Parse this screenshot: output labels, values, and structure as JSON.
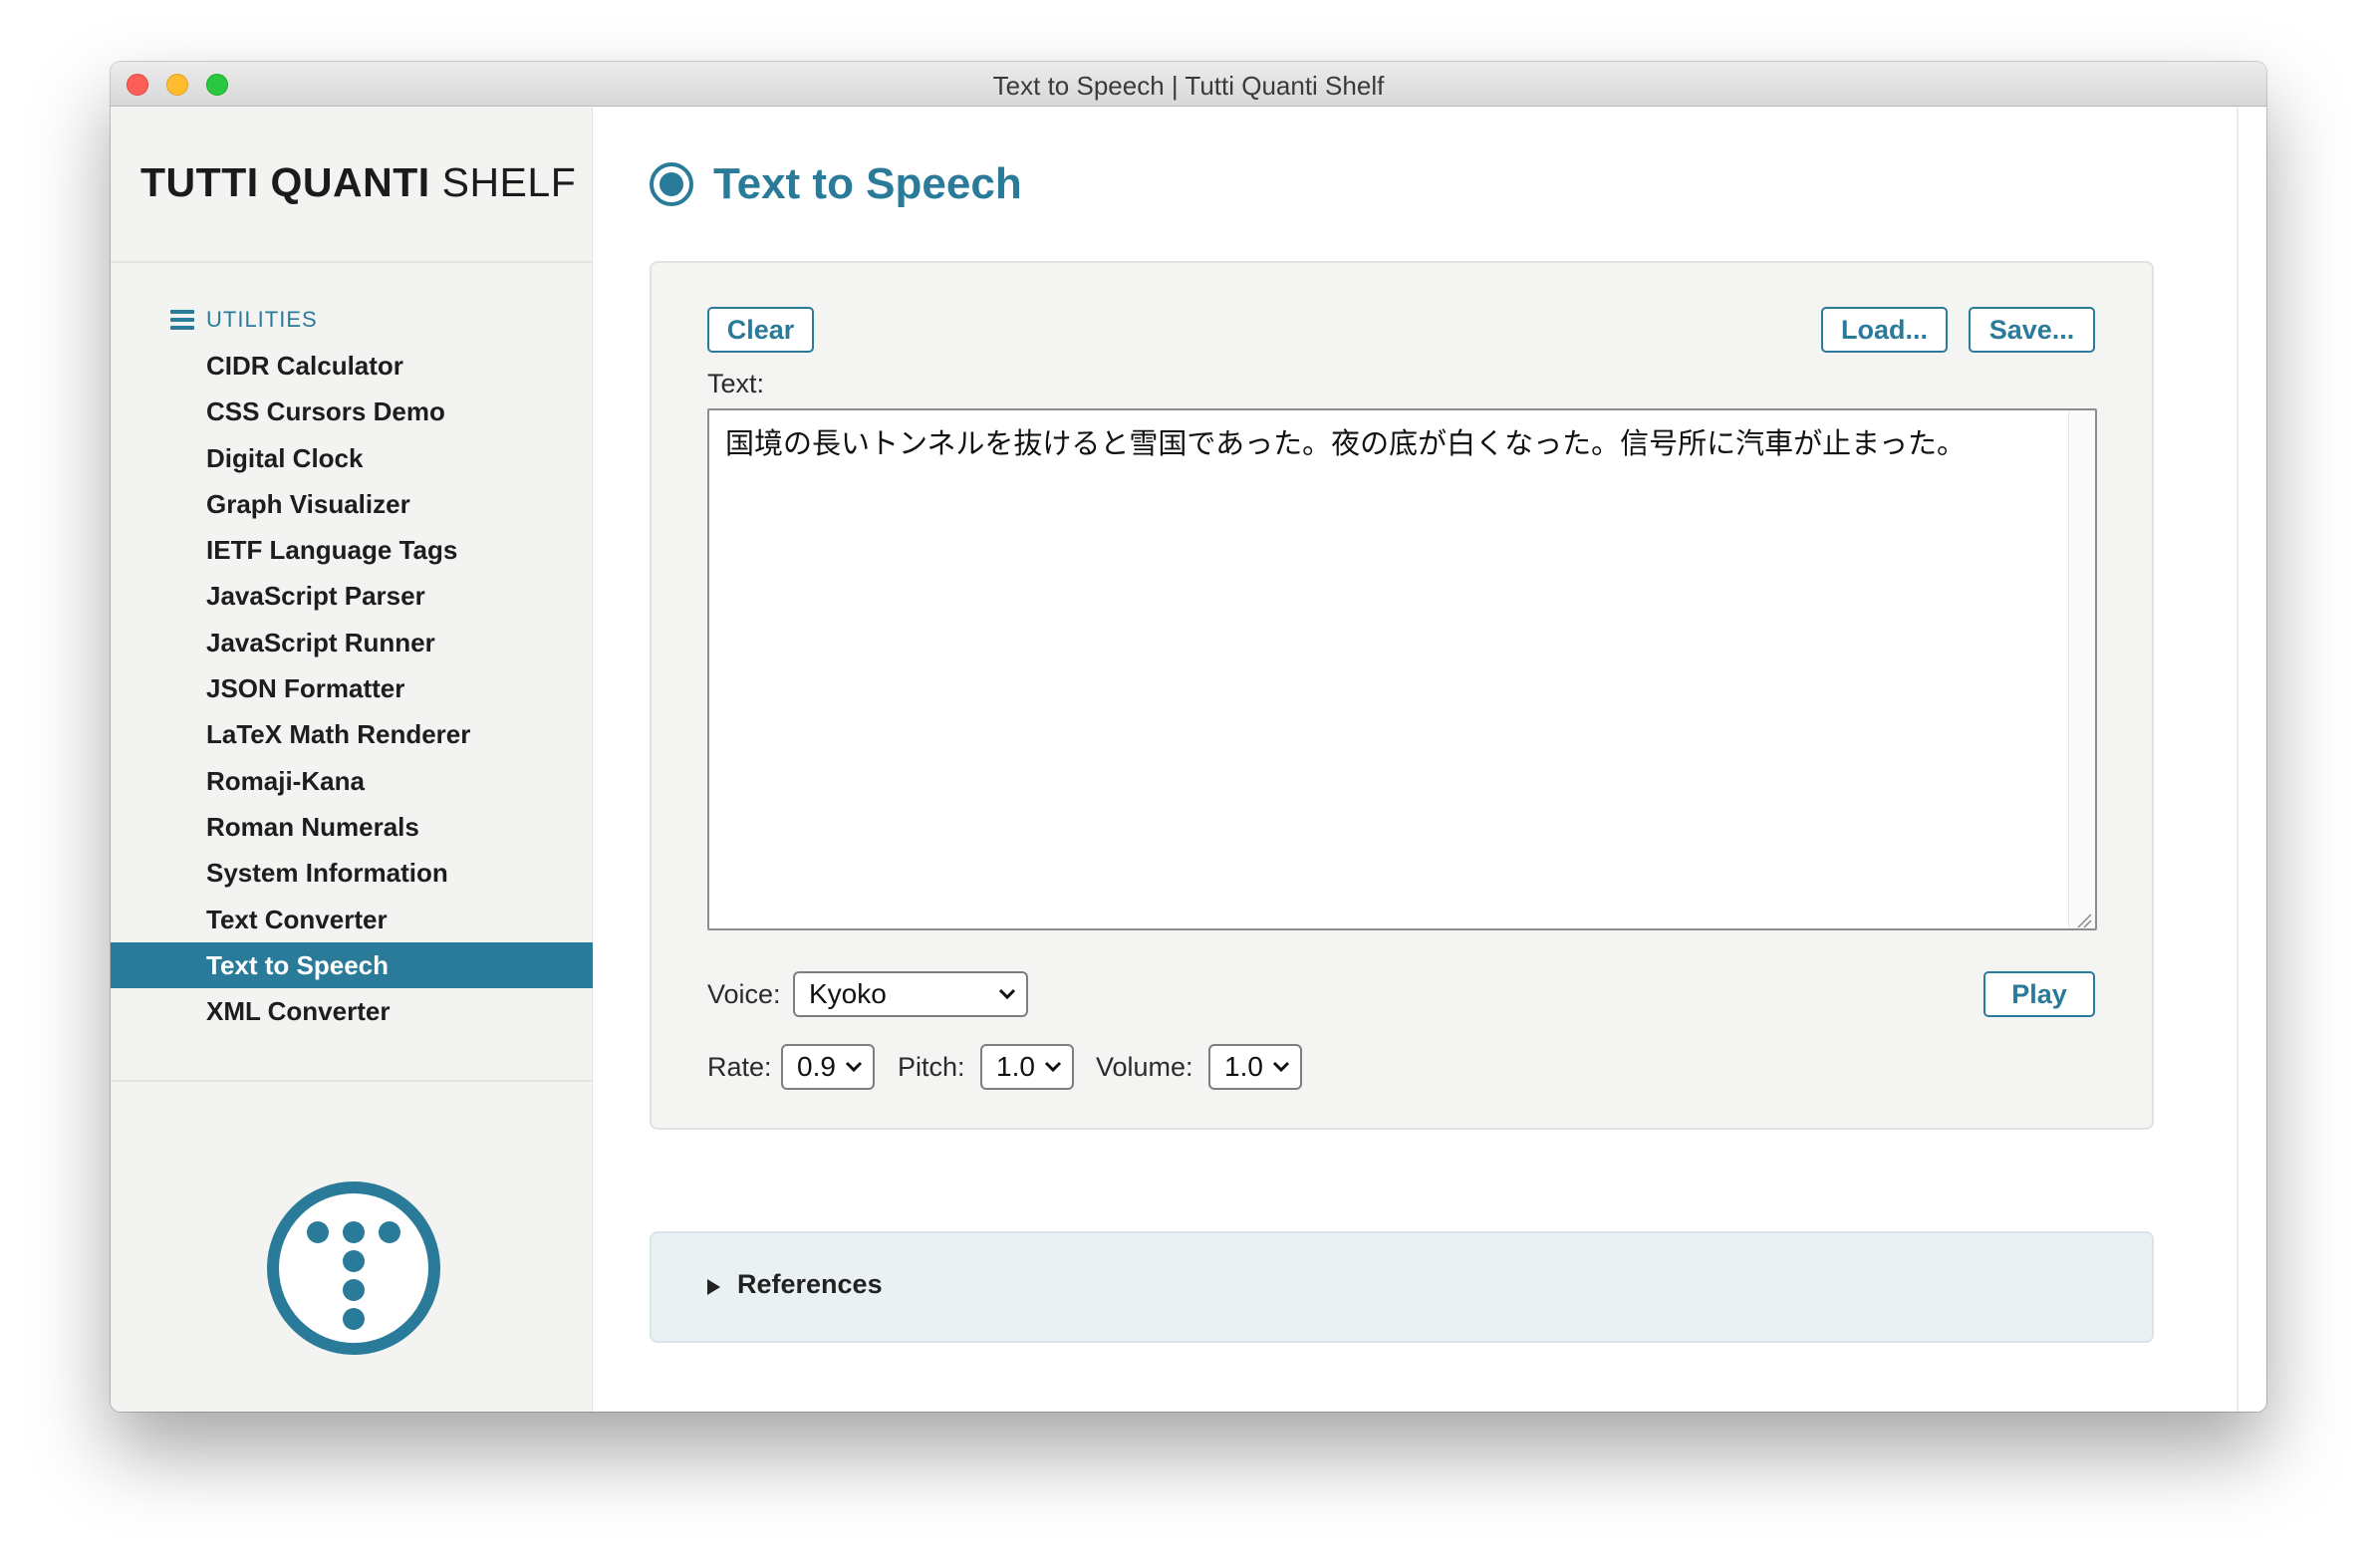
{
  "window": {
    "title": "Text to Speech | Tutti Quanti Shelf"
  },
  "sidebar": {
    "brand_bold": "TUTTI QUANTI",
    "brand_light": "SHELF",
    "section_label": "UTILITIES",
    "items": [
      {
        "label": "CIDR Calculator"
      },
      {
        "label": "CSS Cursors Demo"
      },
      {
        "label": "Digital Clock"
      },
      {
        "label": "Graph Visualizer"
      },
      {
        "label": "IETF Language Tags"
      },
      {
        "label": "JavaScript Parser"
      },
      {
        "label": "JavaScript Runner"
      },
      {
        "label": "JSON Formatter"
      },
      {
        "label": "LaTeX Math Renderer"
      },
      {
        "label": "Romaji-Kana"
      },
      {
        "label": "Roman Numerals"
      },
      {
        "label": "System Information"
      },
      {
        "label": "Text Converter"
      },
      {
        "label": "Text to Speech",
        "active": true
      },
      {
        "label": "XML Converter"
      }
    ]
  },
  "main": {
    "title": "Text to Speech",
    "buttons": {
      "clear": "Clear",
      "load": "Load...",
      "save": "Save...",
      "play": "Play"
    },
    "text_label": "Text:",
    "text_value": "国境の長いトンネルを抜けると雪国であった。夜の底が白くなった。信号所に汽車が止まった。",
    "voice_label": "Voice:",
    "voice_value": "Kyoko",
    "rate_label": "Rate:",
    "rate_value": "0.9",
    "pitch_label": "Pitch:",
    "pitch_value": "1.0",
    "volume_label": "Volume:",
    "volume_value": "1.0",
    "references_label": "References"
  },
  "colors": {
    "accent": "#2a7a9a",
    "panel": "#f4f4f2",
    "references_bg": "#eaf1f3"
  }
}
